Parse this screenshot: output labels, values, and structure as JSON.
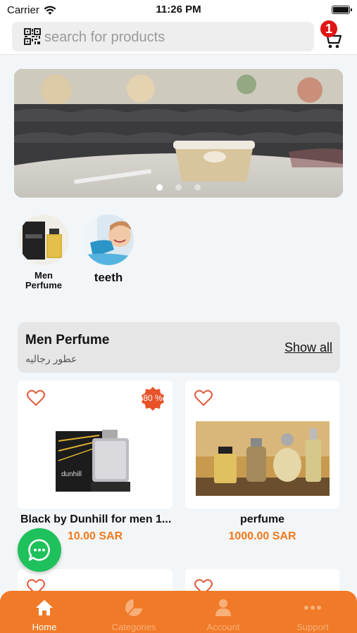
{
  "status_bar": {
    "carrier": "Carrier",
    "time": "11:26 PM"
  },
  "search": {
    "placeholder": "search for products"
  },
  "cart": {
    "count": "1"
  },
  "banner": {
    "slides": 3,
    "active_index": 0
  },
  "categories": [
    {
      "label": "Men Perfume",
      "icon": "perfume-bottle"
    },
    {
      "label": "teeth",
      "icon": "dental-patient"
    }
  ],
  "section": {
    "title": "Men Perfume",
    "subtitle": "عطور رجاليه",
    "show_all": "Show all"
  },
  "products": [
    {
      "name": "Black by Dunhill for men 1...",
      "price": "10.00 SAR",
      "discount": "80 %"
    },
    {
      "name": "perfume",
      "price": "1000.00 SAR"
    }
  ],
  "tabs": [
    {
      "label": "Home",
      "icon": "home-icon",
      "active": true
    },
    {
      "label": "Categories",
      "icon": "pie-chart-icon",
      "active": false
    },
    {
      "label": "Account",
      "icon": "user-icon",
      "active": false
    },
    {
      "label": "Support",
      "icon": "more-icon",
      "active": false
    }
  ],
  "colors": {
    "accent": "#f07a27",
    "price": "#f07a1c",
    "badge": "#e01515",
    "whatsapp": "#1fc15c",
    "discount": "#e8532a"
  }
}
